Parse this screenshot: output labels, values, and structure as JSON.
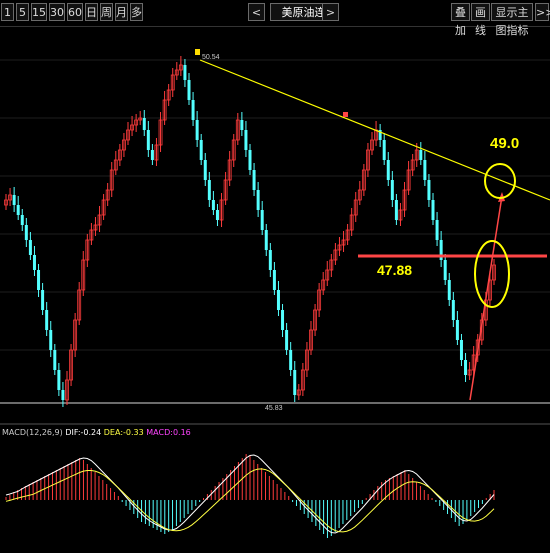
{
  "toolbar": {
    "timeframes": [
      "1",
      "5",
      "15",
      "30",
      "60",
      "日",
      "周",
      "月",
      "多"
    ],
    "prev_arrow": "<",
    "next_arrow": ">",
    "title": "美原油连",
    "right_buttons": [
      "叠加",
      "画线",
      "显示主图指标"
    ],
    "more": ">>"
  },
  "price_labels": {
    "high": "50.54",
    "low": "45.83"
  },
  "annotations": {
    "level_label": "47.88",
    "target_label": "49.0"
  },
  "macd": {
    "name": "MACD(12,26,9)",
    "dif": "DIF:-0.24",
    "dea": "DEA:-0.33",
    "macd": "MACD:0.16"
  },
  "colors": {
    "up": "#ff3c3c",
    "down": "#54ffff",
    "trendline": "#ffff00",
    "level": "#ff3c3c",
    "macd_label": "#ff44ff"
  }
}
